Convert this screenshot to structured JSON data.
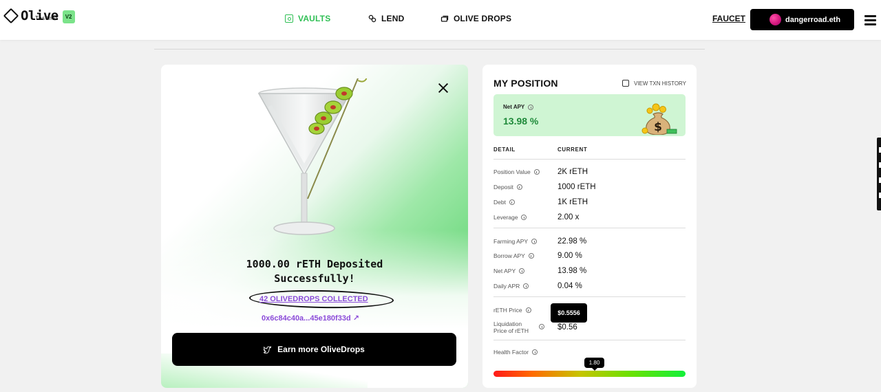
{
  "brand": {
    "name": "Olive",
    "sub": "Testnet",
    "badge": "V2"
  },
  "nav": {
    "vaults": "VAULTS",
    "lend": "LEND",
    "drops": "OLIVE DROPS"
  },
  "header": {
    "faucet": "FAUCET",
    "wallet": "dangerroad.eth"
  },
  "modal": {
    "line1": "1000.00 rETH Deposited",
    "line2": "Successfully!",
    "drops_link": "42 OLIVEDROPS COLLECTED",
    "tx_link": "0x6c84c40a...45e180f33d ↗",
    "earn_button": "Earn more OliveDrops"
  },
  "position": {
    "title": "MY POSITION",
    "txn_history": "VIEW TXN HISTORY",
    "net_apy_label": "Net APY",
    "net_apy_value": "13.98 %",
    "col_detail": "DETAIL",
    "col_current": "CURRENT",
    "rows": [
      {
        "label": "Position Value",
        "value": "2K rETH"
      },
      {
        "label": "Deposit",
        "value": "1000 rETH"
      },
      {
        "label": "Debt",
        "value": "1K rETH"
      },
      {
        "label": "Leverage",
        "value": "2.00 x"
      },
      {
        "label": "Farming APY",
        "value": "22.98 %"
      },
      {
        "label": "Borrow APY",
        "value": "9.00 %"
      },
      {
        "label": "Net APY",
        "value": "13.98 %"
      },
      {
        "label": "Daily APR",
        "value": "0.04 %"
      }
    ],
    "reth_price_label": "rETH Price",
    "reth_price_tooltip": "$0.5556",
    "liq_label_1": "Liquidation",
    "liq_label_2": "Price of rETH",
    "liq_value": "$0.56",
    "health_label": "Health Factor",
    "health_value": "1.80"
  },
  "colors": {
    "accent_green": "#2fbf54",
    "link_purple": "#8a4bd8"
  }
}
